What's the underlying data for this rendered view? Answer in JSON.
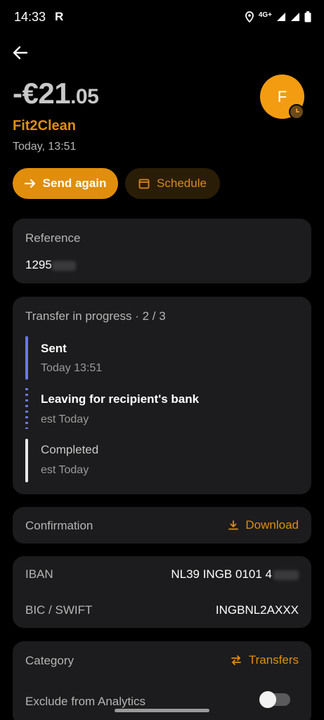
{
  "status_bar": {
    "time": "14:33",
    "carrier_glyph": "R",
    "network": "4G+"
  },
  "header": {
    "back_icon": "arrow-left-icon"
  },
  "transaction": {
    "amount_main": "-€21",
    "amount_cents": ".05",
    "merchant": "Fit2Clean",
    "datetime": "Today, 13:51",
    "avatar_letter": "F"
  },
  "actions": {
    "send_again": "Send again",
    "schedule": "Schedule"
  },
  "reference": {
    "label": "Reference",
    "value": "1295"
  },
  "progress": {
    "title": "Transfer in progress · 2 / 3",
    "steps": [
      {
        "title": "Sent",
        "subtitle": "Today 13:51"
      },
      {
        "title": "Leaving for recipient's bank",
        "subtitle": "est Today"
      },
      {
        "title": "Completed",
        "subtitle": "est Today"
      }
    ]
  },
  "confirmation": {
    "label": "Confirmation",
    "action": "Download"
  },
  "bank": {
    "iban_label": "IBAN",
    "iban_value": "NL39 INGB 0101 4",
    "bic_label": "BIC / SWIFT",
    "bic_value": "INGBNL2AXXX"
  },
  "category": {
    "label": "Category",
    "value": "Transfers",
    "exclude_label": "Exclude from Analytics",
    "exclude_enabled": false
  },
  "colors": {
    "accent": "#e08e0b",
    "progress": "#6a78e6",
    "card": "#1c1c1e",
    "background": "#000000"
  }
}
